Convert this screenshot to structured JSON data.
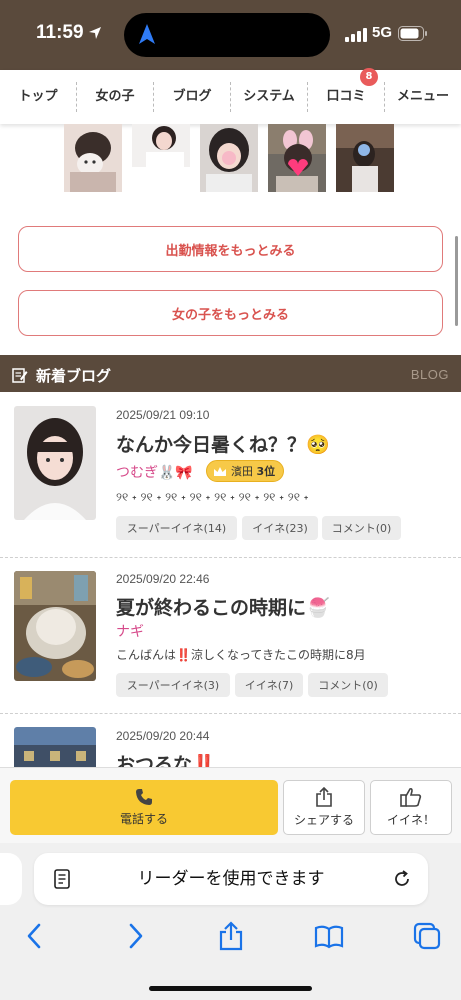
{
  "status_bar": {
    "time": "11:59",
    "network": "5G"
  },
  "nav": {
    "items": [
      {
        "label": "トップ"
      },
      {
        "label": "女の子"
      },
      {
        "label": "ブログ"
      },
      {
        "label": "システム"
      },
      {
        "label": "口コミ",
        "badge": "8"
      },
      {
        "label": "メニュー"
      }
    ]
  },
  "buttons": {
    "schedule_more": "出勤情報をもっとみる",
    "girls_more": "女の子をもっとみる"
  },
  "blog_section": {
    "title": "新着ブログ",
    "subtitle": "BLOG"
  },
  "blog_entries": [
    {
      "date": "2025/09/21 09:10",
      "title": "なんか今日暑くね？？🥺",
      "author": "つむぎ🐰🎀",
      "rank": {
        "area": "濱田",
        "rank": "3位"
      },
      "excerpt": "୨୧ ˖ ୨୧ ˖ ୨୧ ˖ ୨୧ ˖ ୨୧ ˖ ୨୧ ˖ ୨୧ ˖ ୨୧ ˖",
      "super_like": "スーパーイイネ(14)",
      "like": "イイネ(23)",
      "comment": "コメント(0)"
    },
    {
      "date": "2025/09/20 22:46",
      "title": "夏が終わるこの時期に🍧",
      "author": "ナギ",
      "excerpt": "こんばんは‼️涼しくなってきたこの時期に8月",
      "super_like": "スーパーイイネ(3)",
      "like": "イイネ(7)",
      "comment": "コメント(0)"
    },
    {
      "date": "2025/09/20 20:44",
      "title": "おつるな‼️"
    }
  ],
  "action_bar": {
    "call": "電話する",
    "share": "シェアする",
    "like": "イイネ！"
  },
  "safari": {
    "reader_text": "リーダーを使用できます"
  },
  "icons": {
    "location": "location-arrow-icon",
    "signal": "signal-bars-icon",
    "battery": "battery-icon",
    "blog": "edit-note-icon",
    "crown": "crown-icon",
    "phone": "phone-icon",
    "share": "share-icon",
    "thumbs_up": "thumbs-up-icon",
    "reader": "reader-icon",
    "reload": "reload-icon",
    "back": "chevron-left-icon",
    "forward": "chevron-right-icon",
    "bookmarks": "book-icon",
    "tabs": "tabs-icon"
  },
  "colors": {
    "header_brown": "#5a4a3c",
    "accent_red": "#d9534f",
    "author_pink": "#d64a8a",
    "call_yellow": "#f8c932"
  }
}
